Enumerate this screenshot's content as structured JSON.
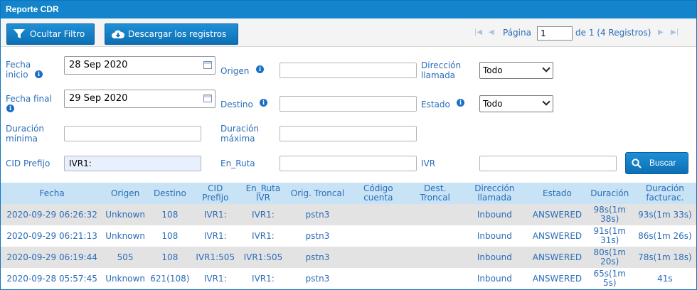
{
  "window": {
    "title": "Reporte CDR"
  },
  "toolbar": {
    "filter_button": "Ocultar Filtro",
    "download_button": "Descargar los registros",
    "pager": {
      "page_label": "Página",
      "page_value": "1",
      "page_of": "de 1 (4 Registros)"
    }
  },
  "filters": {
    "fecha_inicio": {
      "label": "Fecha inicio",
      "value": "28 Sep 2020"
    },
    "fecha_final": {
      "label": "Fecha final",
      "value": "29 Sep 2020"
    },
    "duracion_minima": {
      "label": "Duración mínima",
      "value": ""
    },
    "cid_prefijo": {
      "label": "CID Prefijo",
      "value": "IVR1:"
    },
    "origen": {
      "label": "Origen",
      "value": ""
    },
    "destino": {
      "label": "Destino",
      "value": ""
    },
    "duracion_maxima": {
      "label": "Duración máxima",
      "value": ""
    },
    "en_ruta": {
      "label": "En_Ruta",
      "value": ""
    },
    "direccion": {
      "label": "Dirección llamada",
      "selected": "Todo"
    },
    "estado": {
      "label": "Estado",
      "selected": "Todo"
    },
    "ivr": {
      "label": "IVR",
      "value": ""
    },
    "search_button": "Buscar"
  },
  "table": {
    "headers": [
      "Fecha",
      "Origen",
      "Destino",
      "CID Prefijo",
      "En_Ruta IVR",
      "Orig. Troncal",
      "Código cuenta",
      "Dest. Troncal",
      "Dirección llamada",
      "Estado",
      "Duración",
      "Duración facturac."
    ],
    "rows": [
      [
        "2020-09-29 06:26:32",
        "Unknown",
        "108",
        "IVR1:",
        "IVR1:",
        "pstn3",
        "",
        "",
        "Inbound",
        "ANSWERED",
        "98s(1m 38s)",
        "93s(1m 33s)"
      ],
      [
        "2020-09-29 06:21:13",
        "Unknown",
        "108",
        "IVR1:",
        "IVR1:",
        "pstn3",
        "",
        "",
        "Inbound",
        "ANSWERED",
        "91s(1m 31s)",
        "86s(1m 26s)"
      ],
      [
        "2020-09-29 06:19:44",
        "505",
        "108",
        "IVR1:505",
        "IVR1:505",
        "pstn3",
        "",
        "",
        "Inbound",
        "ANSWERED",
        "80s(1m 20s)",
        "78s(1m 18s)"
      ],
      [
        "2020-09-28 05:57:45",
        "Unknown",
        "621(108)",
        "IVR1:",
        "IVR1:",
        "pstn3",
        "",
        "",
        "Inbound",
        "ANSWERED",
        "65s(1m 5s)",
        "41s"
      ]
    ]
  },
  "icons": {
    "filter": "filter-icon",
    "download": "cloud-download-icon",
    "search": "search-icon",
    "info": "info-icon",
    "calendar": "calendar-icon",
    "pager_first": "first-page-icon",
    "pager_prev": "prev-page-icon",
    "pager_next": "next-page-icon",
    "pager_last": "last-page-icon"
  },
  "colors": {
    "accent": "#1485cc",
    "header_bg": "#c8e3f5",
    "text": "#2a6db8"
  }
}
